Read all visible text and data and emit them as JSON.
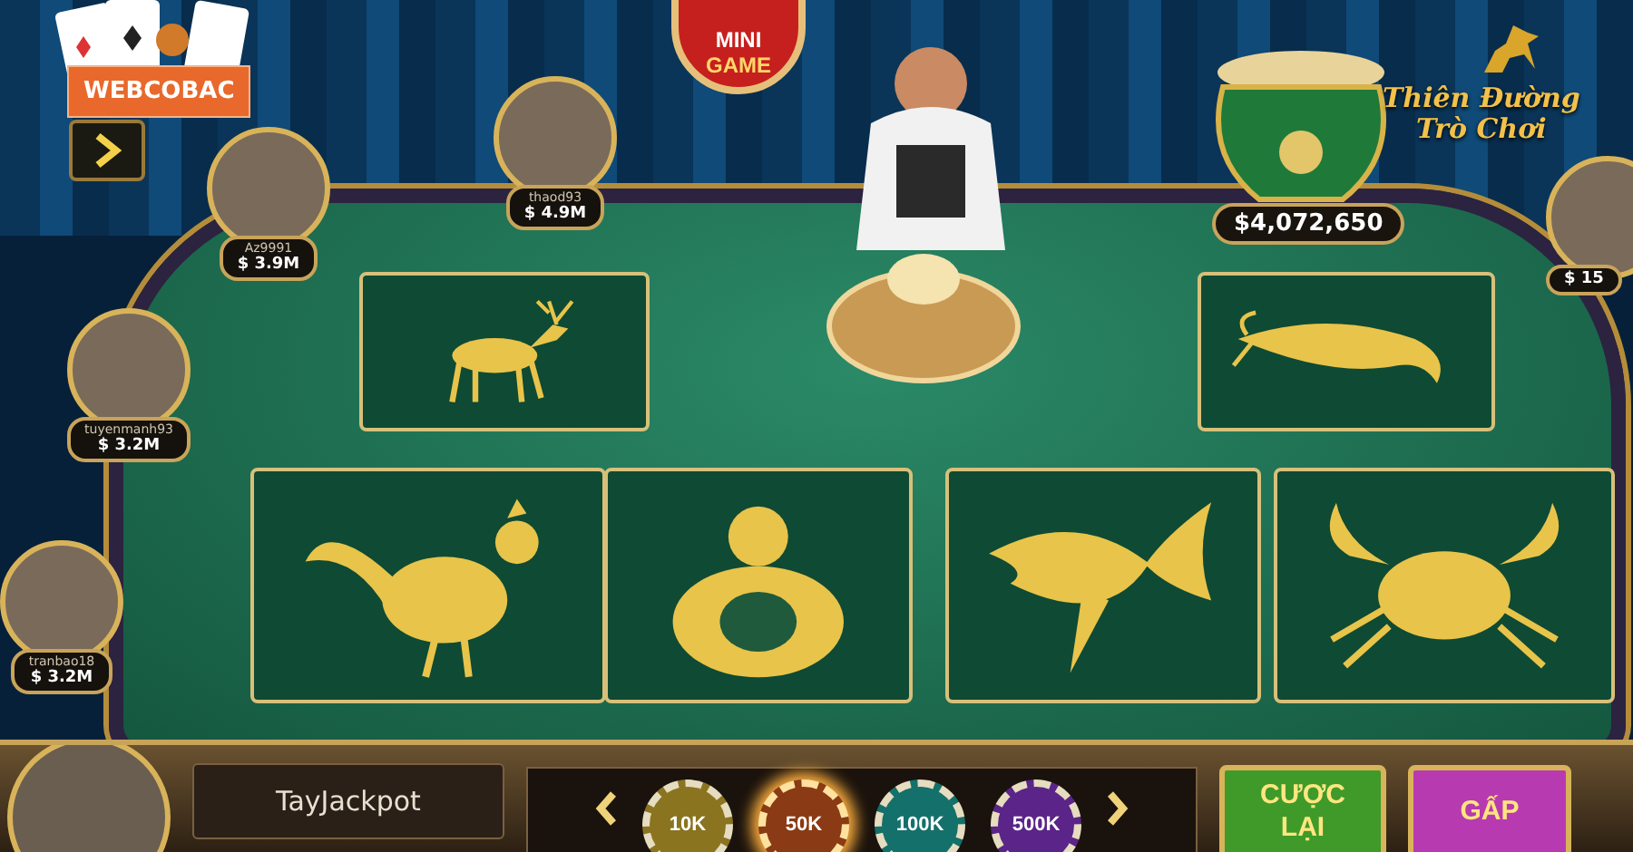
{
  "brand": {
    "label": "WEBCOBAC"
  },
  "mini_game": {
    "line1": "MINI",
    "line2": "GAME"
  },
  "logo": {
    "line1": "Thiên Đường",
    "line2": "Trò Chơi"
  },
  "jackpot": {
    "amount": "$4,072,650"
  },
  "players": [
    {
      "name": "Az9991",
      "balance": "$ 3.9M"
    },
    {
      "name": "thaod93",
      "balance": "$ 4.9M"
    },
    {
      "name": "tuyenmanh93",
      "balance": "$ 3.2M"
    },
    {
      "name": "tranbao18",
      "balance": "$ 3.2M"
    },
    {
      "balance": "$ 15"
    }
  ],
  "bet_tiles": [
    {
      "kind": "deer"
    },
    {
      "kind": "shrimp"
    },
    {
      "kind": "rooster"
    },
    {
      "kind": "gourd"
    },
    {
      "kind": "fish"
    },
    {
      "kind": "crab"
    }
  ],
  "bottom_bar": {
    "player_name": "TayJackpot",
    "chips": [
      {
        "label": "10K",
        "selected": false,
        "color": "#8a7420"
      },
      {
        "label": "50K",
        "selected": true,
        "color": "#8a3a14"
      },
      {
        "label": "100K",
        "selected": false,
        "color": "#14706a"
      },
      {
        "label": "500K",
        "selected": false,
        "color": "#5a2488"
      }
    ],
    "buttons": [
      {
        "label": "CƯỢC\nLẠI",
        "kind": "rebet"
      },
      {
        "label": "GẤP",
        "kind": "double"
      }
    ]
  }
}
